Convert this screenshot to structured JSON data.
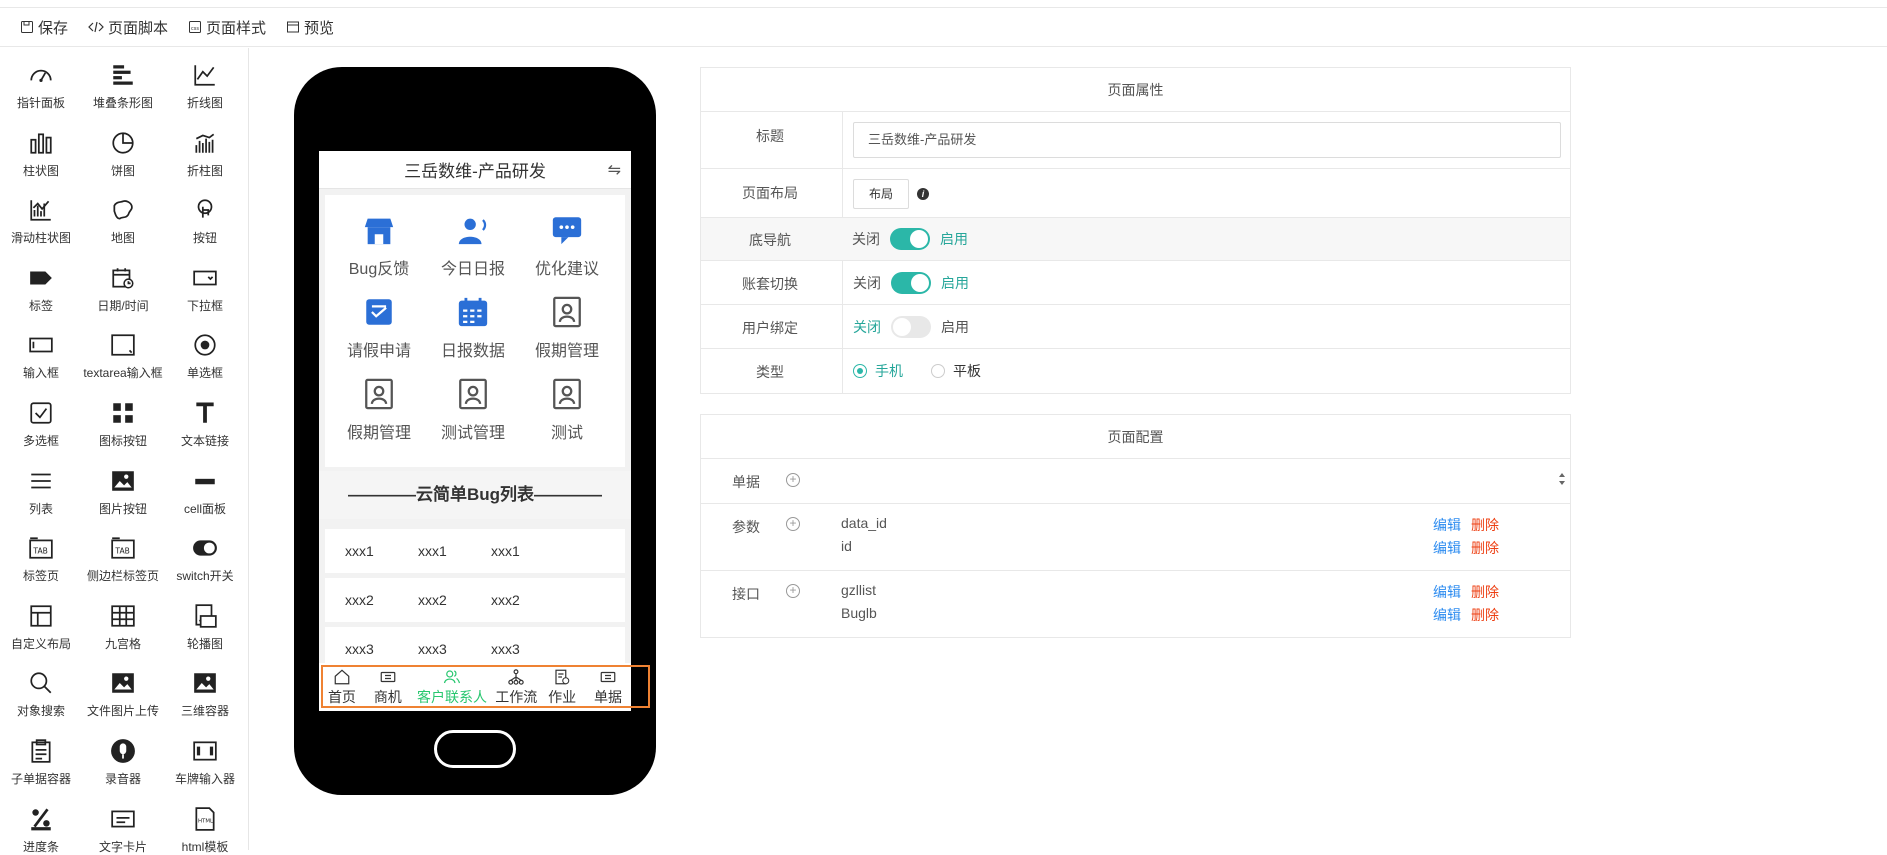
{
  "toolbar": {
    "save": "保存",
    "script": "页面脚本",
    "style": "页面样式",
    "preview": "预览"
  },
  "components": [
    {
      "label": "指针面板",
      "icon": "gauge-icon"
    },
    {
      "label": "堆叠条形图",
      "icon": "stacked-bar-icon"
    },
    {
      "label": "折线图",
      "icon": "line-chart-icon"
    },
    {
      "label": "柱状图",
      "icon": "bar-chart-icon"
    },
    {
      "label": "饼图",
      "icon": "pie-chart-icon"
    },
    {
      "label": "折柱图",
      "icon": "bar-line-icon"
    },
    {
      "label": "滑动柱状图",
      "icon": "sliding-bar-icon"
    },
    {
      "label": "地图",
      "icon": "map-icon"
    },
    {
      "label": "按钮",
      "icon": "pointer-icon"
    },
    {
      "label": "标签",
      "icon": "tag-icon"
    },
    {
      "label": "日期/时间",
      "icon": "calendar-clock-icon"
    },
    {
      "label": "下拉框",
      "icon": "dropdown-icon"
    },
    {
      "label": "输入框",
      "icon": "input-icon"
    },
    {
      "label": "textarea输入框",
      "icon": "textarea-icon"
    },
    {
      "label": "单选框",
      "icon": "radio-icon"
    },
    {
      "label": "多选框",
      "icon": "checkbox-icon"
    },
    {
      "label": "图标按钮",
      "icon": "grid-dots-icon"
    },
    {
      "label": "文本链接",
      "icon": "text-t-icon"
    },
    {
      "label": "列表",
      "icon": "list-icon"
    },
    {
      "label": "图片按钮",
      "icon": "image-icon"
    },
    {
      "label": "cell面板",
      "icon": "cell-icon"
    },
    {
      "label": "标签页",
      "icon": "tab-icon"
    },
    {
      "label": "侧边栏标签页",
      "icon": "side-tab-icon"
    },
    {
      "label": "switch开关",
      "icon": "switch-icon"
    },
    {
      "label": "自定义布局",
      "icon": "layout-icon"
    },
    {
      "label": "九宫格",
      "icon": "table-grid-icon"
    },
    {
      "label": "轮播图",
      "icon": "carousel-icon"
    },
    {
      "label": "对象搜索",
      "icon": "search-icon"
    },
    {
      "label": "文件图片上传",
      "icon": "upload-image-icon"
    },
    {
      "label": "三维容器",
      "icon": "3d-container-icon"
    },
    {
      "label": "子单据容器",
      "icon": "clipboard-icon"
    },
    {
      "label": "录音器",
      "icon": "microphone-icon"
    },
    {
      "label": "车牌输入器",
      "icon": "plate-icon"
    },
    {
      "label": "进度条",
      "icon": "percent-icon"
    },
    {
      "label": "文字卡片",
      "icon": "card-icon"
    },
    {
      "label": "html模板",
      "icon": "html-file-icon"
    }
  ],
  "phone": {
    "title": "三岳数维-产品研发",
    "grid": [
      {
        "label": "Bug反馈",
        "icon": "store-icon",
        "color": "#2b6fd6"
      },
      {
        "label": "今日日报",
        "icon": "user-talk-icon",
        "color": "#2b6fd6"
      },
      {
        "label": "优化建议",
        "icon": "chat-icon",
        "color": "#2b6fd6"
      },
      {
        "label": "请假申请",
        "icon": "check-doc-icon",
        "color": "#2b6fd6"
      },
      {
        "label": "日报数据",
        "icon": "calendar-icon",
        "color": "#2b6fd6"
      },
      {
        "label": "假期管理",
        "icon": "badge-icon",
        "color": "#555555"
      },
      {
        "label": "假期管理",
        "icon": "badge-icon",
        "color": "#555555"
      },
      {
        "label": "测试管理",
        "icon": "badge-icon",
        "color": "#555555"
      },
      {
        "label": "测试",
        "icon": "badge-icon",
        "color": "#555555"
      }
    ],
    "bug_title": "————云简单Bug列表————",
    "rows": [
      [
        "xxx1",
        "xxx1",
        "xxx1"
      ],
      [
        "xxx2",
        "xxx2",
        "xxx2"
      ],
      [
        "xxx3",
        "xxx3",
        "xxx3"
      ]
    ],
    "bottom_nav": [
      {
        "label": "首页",
        "icon": "home-icon",
        "active": false
      },
      {
        "label": "商机",
        "icon": "ticket-icon",
        "active": false
      },
      {
        "label": "客户联系人",
        "icon": "contacts-icon",
        "active": true
      },
      {
        "label": "工作流",
        "icon": "workflow-icon",
        "active": false
      },
      {
        "label": "作业",
        "icon": "task-icon",
        "active": false
      },
      {
        "label": "单据",
        "icon": "receipt-icon",
        "active": false
      }
    ]
  },
  "props": {
    "header": "页面属性",
    "title_label": "标题",
    "title_value": "三岳数维-产品研发",
    "layout_label": "页面布局",
    "layout_btn": "布局",
    "bottom_nav_label": "底导航",
    "account_label": "账套切换",
    "bind_label": "用户绑定",
    "type_label": "类型",
    "off": "关闭",
    "on": "启用",
    "bottom_nav_on": true,
    "account_on": true,
    "bind_on": false,
    "type_options": [
      "手机",
      "平板"
    ],
    "type_selected": "手机"
  },
  "config": {
    "header": "页面配置",
    "doc_label": "单据",
    "param_label": "参数",
    "api_label": "接口",
    "params": [
      "data_id",
      "id"
    ],
    "apis": [
      "gzllist",
      "Buglb"
    ],
    "edit": "编辑",
    "delete": "删除"
  }
}
